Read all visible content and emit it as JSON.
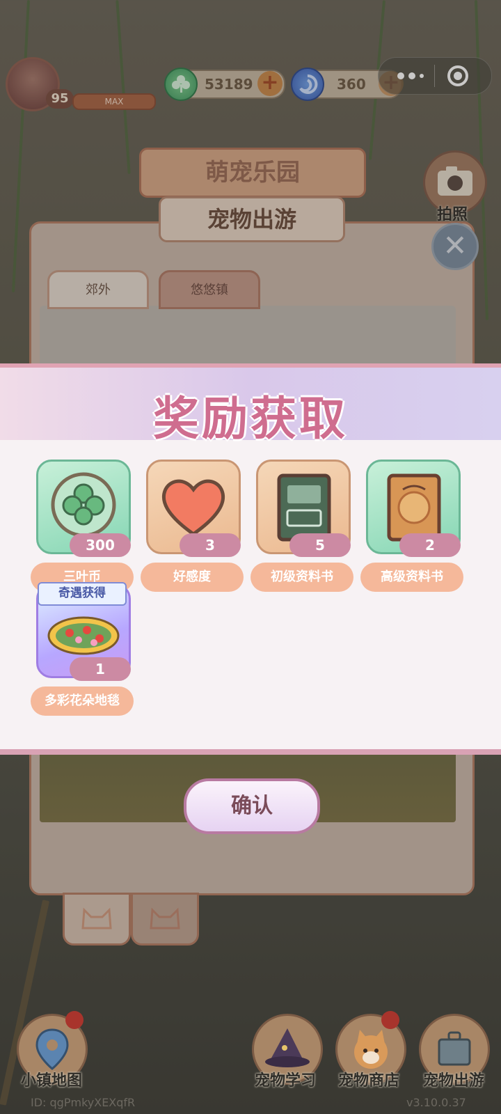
{
  "hud": {
    "level": "95",
    "level_max_label": "MAX",
    "clover_coins": "53189",
    "swirl_gems": "360",
    "camera_label": "拍照"
  },
  "panel": {
    "park_title": "萌宠乐园",
    "outing_title": "宠物出游",
    "tabs": [
      {
        "label": "郊外"
      },
      {
        "label": "悠悠镇"
      }
    ]
  },
  "reward": {
    "title": "奖励获取",
    "items": [
      {
        "name": "三叶币",
        "count": "300",
        "icon": "clover-coin-icon"
      },
      {
        "name": "好感度",
        "count": "3",
        "icon": "heart-icon"
      },
      {
        "name": "初级资料书",
        "count": "5",
        "icon": "beginner-book-icon"
      },
      {
        "name": "高级资料书",
        "count": "2",
        "icon": "advanced-book-icon"
      },
      {
        "name": "多彩花朵地毯",
        "count": "1",
        "icon": "flower-rug-icon",
        "ribbon": "奇遇获得"
      }
    ],
    "confirm_label": "确认"
  },
  "bottom_nav": {
    "town_map": "小镇地图",
    "pet_study": "宠物学习",
    "pet_shop": "宠物商店",
    "pet_outing": "宠物出游"
  },
  "footer": {
    "id_text": "ID: qgPmkyXEXqfR",
    "version": "v3.10.0.37"
  },
  "colors": {
    "reward_title": "#cf6d8f",
    "count_badge": "#cc8aa3",
    "name_pill": "#f5b89a"
  }
}
